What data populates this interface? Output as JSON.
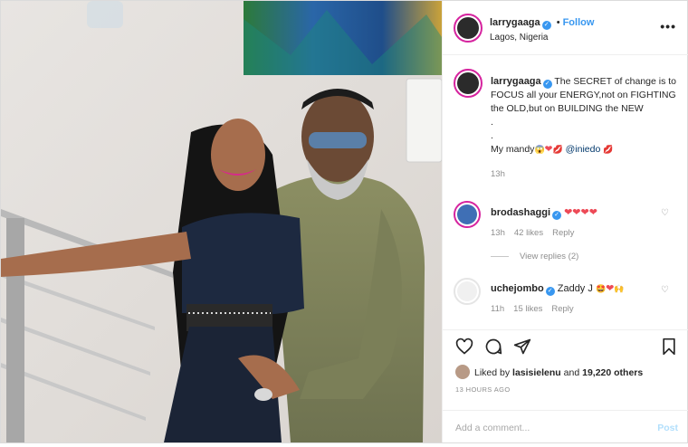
{
  "header": {
    "username": "larrygaaga",
    "separator": "•",
    "follow_label": "Follow",
    "location": "Lagos, Nigeria",
    "more_label": "•••"
  },
  "caption": {
    "username": "larrygaaga",
    "line1": "The SECRET of change is to FOCUS all your ENERGY,not on FIGHTING the OLD,but on BUILDING the NEW",
    "dot1": ".",
    "dot2": ".",
    "line2_prefix": "My mandy",
    "mention": "@iniedo",
    "time": "13h"
  },
  "comments": [
    {
      "username": "brodashaggi",
      "time": "13h",
      "likes": "42 likes",
      "reply": "Reply"
    },
    {
      "username": "uchejombo",
      "text": "Zaddy J",
      "time": "11h",
      "likes": "15 likes",
      "reply": "Reply"
    }
  ],
  "view_replies": "View replies (2)",
  "likes": {
    "prefix": "Liked by",
    "user": "lasisielenu",
    "and": "and",
    "others": "19,220 others"
  },
  "posted_time": "13 HOURS AGO",
  "add_comment": {
    "placeholder": "Add a comment...",
    "post_label": "Post"
  },
  "colors": {
    "accent": "#3897f0",
    "border": "#dbdbdb",
    "muted": "#8e8e8e",
    "heart": "#ed4956"
  }
}
